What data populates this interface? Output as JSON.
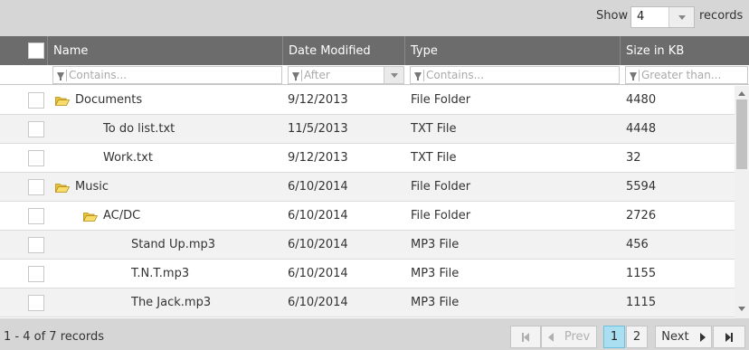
{
  "toolbar": {
    "show_label": "Show",
    "page_size": "4",
    "records_label": "records"
  },
  "columns": [
    {
      "label": "Name",
      "filter_placeholder": "Contains..."
    },
    {
      "label": "Date Modified",
      "filter_placeholder": "After"
    },
    {
      "label": "Type",
      "filter_placeholder": "Contains..."
    },
    {
      "label": "Size in KB",
      "filter_placeholder": "Greater than..."
    }
  ],
  "rows": [
    {
      "name": "Documents",
      "date": "9/12/2013",
      "type": "File Folder",
      "size": "4480",
      "folder": true,
      "level": 0
    },
    {
      "name": "To do list.txt",
      "date": "11/5/2013",
      "type": "TXT File",
      "size": "4448",
      "folder": false,
      "level": 1
    },
    {
      "name": "Work.txt",
      "date": "9/12/2013",
      "type": "TXT File",
      "size": "32",
      "folder": false,
      "level": 1
    },
    {
      "name": "Music",
      "date": "6/10/2014",
      "type": "File Folder",
      "size": "5594",
      "folder": true,
      "level": 0
    },
    {
      "name": "AC/DC",
      "date": "6/10/2014",
      "type": "File Folder",
      "size": "2726",
      "folder": true,
      "level": 1
    },
    {
      "name": "Stand Up.mp3",
      "date": "6/10/2014",
      "type": "MP3 File",
      "size": "456",
      "folder": false,
      "level": 2
    },
    {
      "name": "T.N.T.mp3",
      "date": "6/10/2014",
      "type": "MP3 File",
      "size": "1155",
      "folder": false,
      "level": 2
    },
    {
      "name": "The Jack.mp3",
      "date": "6/10/2014",
      "type": "MP3 File",
      "size": "1115",
      "folder": false,
      "level": 2
    }
  ],
  "pager": {
    "info": "1 - 4 of 7 records",
    "prev_label": "Prev",
    "next_label": "Next",
    "pages": [
      "1",
      "2"
    ],
    "current_page": "1"
  },
  "colors": {
    "header_bg": "#6c6c6c",
    "toolbar_bg": "#d6d6d6",
    "alt_row": "#f2f2f2",
    "active_page": "#a9dff0",
    "folder_icon": "#f2d25c"
  },
  "icons": {
    "folder": "folder-open-icon",
    "filter": "funnel-icon",
    "first": "first-page-icon",
    "prev": "prev-page-icon",
    "next": "next-page-icon",
    "last": "last-page-icon"
  }
}
